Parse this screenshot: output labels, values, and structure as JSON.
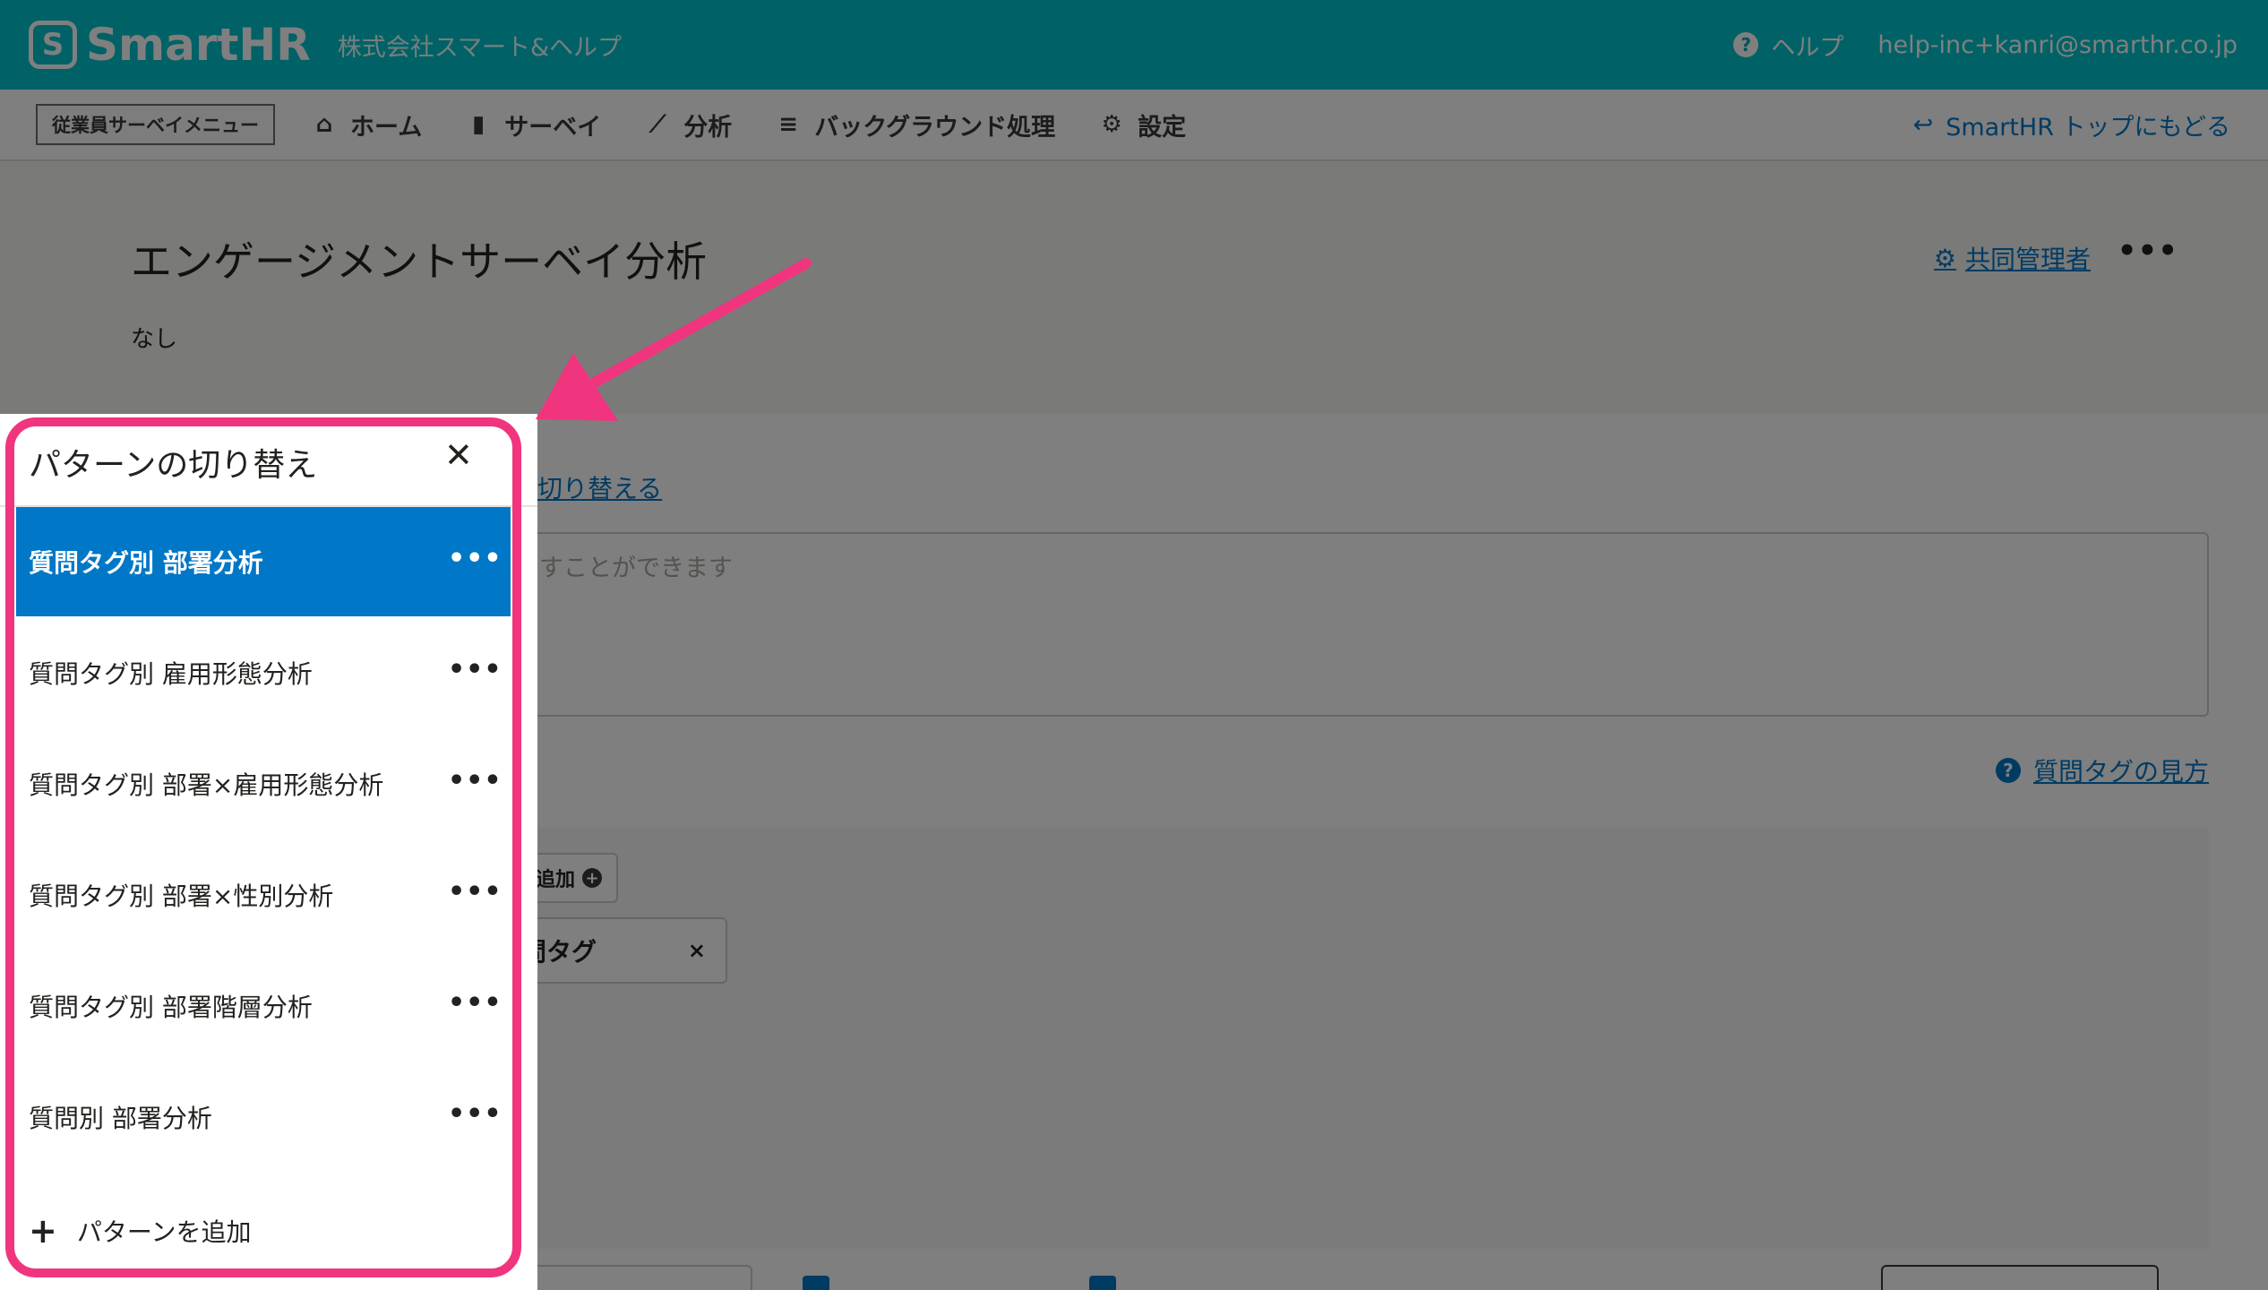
{
  "header": {
    "logo_mark": "S",
    "logo_text": "SmartHR",
    "company": "株式会社スマート&ヘルプ",
    "help_label": "ヘルプ",
    "user_email": "help-inc+kanri@smarthr.co.jp"
  },
  "nav": {
    "menu_badge": "従業員サーベイメニュー",
    "items": [
      {
        "label": "ホーム",
        "icon": "home-icon"
      },
      {
        "label": "サーベイ",
        "icon": "document-icon"
      },
      {
        "label": "分析",
        "icon": "chart-icon"
      },
      {
        "label": "バックグラウンド処理",
        "icon": "database-icon"
      },
      {
        "label": "設定",
        "icon": "gear-icon"
      }
    ],
    "back_link": "SmartHR トップにもどる"
  },
  "page": {
    "title": "エンゲージメントサーベイ分析",
    "subtitle": "なし",
    "co_admin_label": "共同管理者",
    "more": "•••"
  },
  "main": {
    "switch_link": "切り替える",
    "memo_placeholder": "すことができます",
    "qtag_help": "質問タグの見方",
    "add_chip": "追加",
    "tag_chip": "問タグ",
    "tag_chip_close": "×"
  },
  "panel": {
    "title": "パターンの切り替え",
    "close": "✕",
    "items": [
      {
        "label": "質問タグ別 部署分析",
        "active": true
      },
      {
        "label": "質問タグ別 雇用形態分析",
        "active": false
      },
      {
        "label": "質問タグ別 部署×雇用形態分析",
        "active": false
      },
      {
        "label": "質問タグ別 部署×性別分析",
        "active": false
      },
      {
        "label": "質問タグ別 部署階層分析",
        "active": false
      },
      {
        "label": "質問別 部署分析",
        "active": false
      }
    ],
    "item_more": "•••",
    "add_label": "パターンを追加",
    "add_icon": "+"
  },
  "colors": {
    "brand": "#00c4cc",
    "link": "#0077c7",
    "highlight": "#f0357e",
    "active_bg": "#0077c7"
  }
}
